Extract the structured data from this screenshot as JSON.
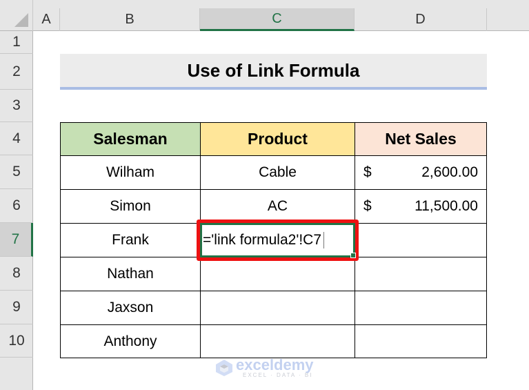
{
  "sheet": {
    "columns": [
      {
        "label": "A",
        "selected": false
      },
      {
        "label": "B",
        "selected": false
      },
      {
        "label": "C",
        "selected": true
      },
      {
        "label": "D",
        "selected": false
      }
    ],
    "rows": [
      "1",
      "2",
      "3",
      "4",
      "5",
      "6",
      "7",
      "8",
      "9",
      "10"
    ],
    "selected_row": "7",
    "active_cell": "C7"
  },
  "title": "Use of Link Formula",
  "table": {
    "headers": {
      "salesman": "Salesman",
      "product": "Product",
      "net_sales": "Net Sales"
    },
    "rows": [
      {
        "salesman": "Wilham",
        "product": "Cable",
        "currency": "$",
        "net_sales": "2,600.00"
      },
      {
        "salesman": "Simon",
        "product": "AC",
        "currency": "$",
        "net_sales": "11,500.00"
      },
      {
        "salesman": "Frank",
        "product": "",
        "currency": "",
        "net_sales": ""
      },
      {
        "salesman": "Nathan",
        "product": "",
        "currency": "",
        "net_sales": ""
      },
      {
        "salesman": "Jaxson",
        "product": "",
        "currency": "",
        "net_sales": ""
      },
      {
        "salesman": "Anthony",
        "product": "",
        "currency": "",
        "net_sales": ""
      }
    ]
  },
  "editing": {
    "formula": "='link formula2'!C7"
  },
  "colors": {
    "excel_green": "#217346",
    "highlight_red": "#ee1111",
    "header_salesman": "#c6e0b4",
    "header_product": "#ffe699",
    "header_net_sales": "#fce4d6",
    "title_underline": "#a9bde4"
  },
  "watermark": {
    "name": "exceldemy",
    "tagline": "EXCEL · DATA · BI"
  }
}
